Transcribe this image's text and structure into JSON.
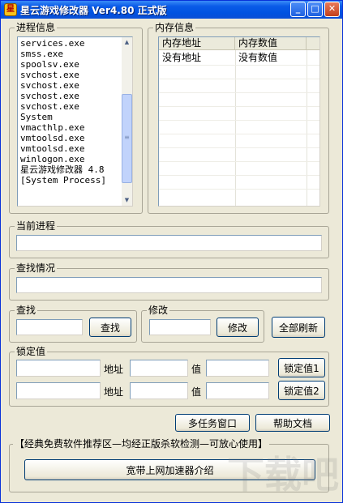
{
  "window": {
    "title": "星云游戏修改器 Ver4.80 正式版",
    "min_glyph": "_",
    "max_glyph": "□",
    "close_glyph": "✕"
  },
  "process_group": {
    "title": "进程信息",
    "processes": [
      "services.exe",
      "smss.exe",
      "spoolsv.exe",
      "svchost.exe",
      "svchost.exe",
      "svchost.exe",
      "svchost.exe",
      "System",
      "vmacthlp.exe",
      "vmtoolsd.exe",
      "vmtoolsd.exe",
      "winlogon.exe",
      "星云游戏修改器 4.8",
      "[System Process]"
    ]
  },
  "memory_group": {
    "title": "内存信息",
    "columns": [
      "内存地址",
      "内存数值"
    ],
    "rows": [
      [
        "没有地址",
        "没有数值"
      ]
    ]
  },
  "current_process": {
    "title": "当前进程",
    "value": ""
  },
  "search_status": {
    "title": "查找情况",
    "value": ""
  },
  "search": {
    "title": "查找",
    "value": "",
    "button": "查找"
  },
  "modify": {
    "title": "修改",
    "value": "",
    "button": "修改"
  },
  "refresh_all_button": "全部刷新",
  "lock_group": {
    "title": "锁定值",
    "address_label": "地址",
    "value_label": "值",
    "rows": [
      {
        "name": "",
        "address": "",
        "value": "",
        "button": "锁定值1"
      },
      {
        "name": "",
        "address": "",
        "value": "",
        "button": "锁定值2"
      }
    ]
  },
  "multitask_button": "多任务窗口",
  "help_button": "帮助文档",
  "promo": {
    "title": "【经典免费软件推荐区—均经正版杀软检测—可放心使用】",
    "button": "宽带上网加速器介绍"
  },
  "watermark": "下载吧"
}
